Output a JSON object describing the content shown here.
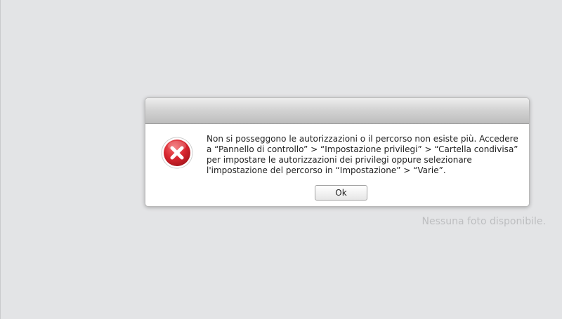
{
  "dialog": {
    "title": "",
    "icon": "error-icon",
    "message": "Non si posseggono le autorizzazioni o il percorso non esiste più. Accedere\na “Pannello di controllo” > “Impostazione privilegi” > “Cartella condivisa”\nper impostare le autorizzazioni dei privilegi oppure selezionare\nl'impostazione del percorso in “Impostazione” > “Varie”.",
    "ok_label": "Ok"
  },
  "main": {
    "empty_message": "Nessuna foto disponibile."
  },
  "colors": {
    "background": "#e3e4e6",
    "error_red": "#d8262f",
    "empty_text": "#bdbec0"
  }
}
